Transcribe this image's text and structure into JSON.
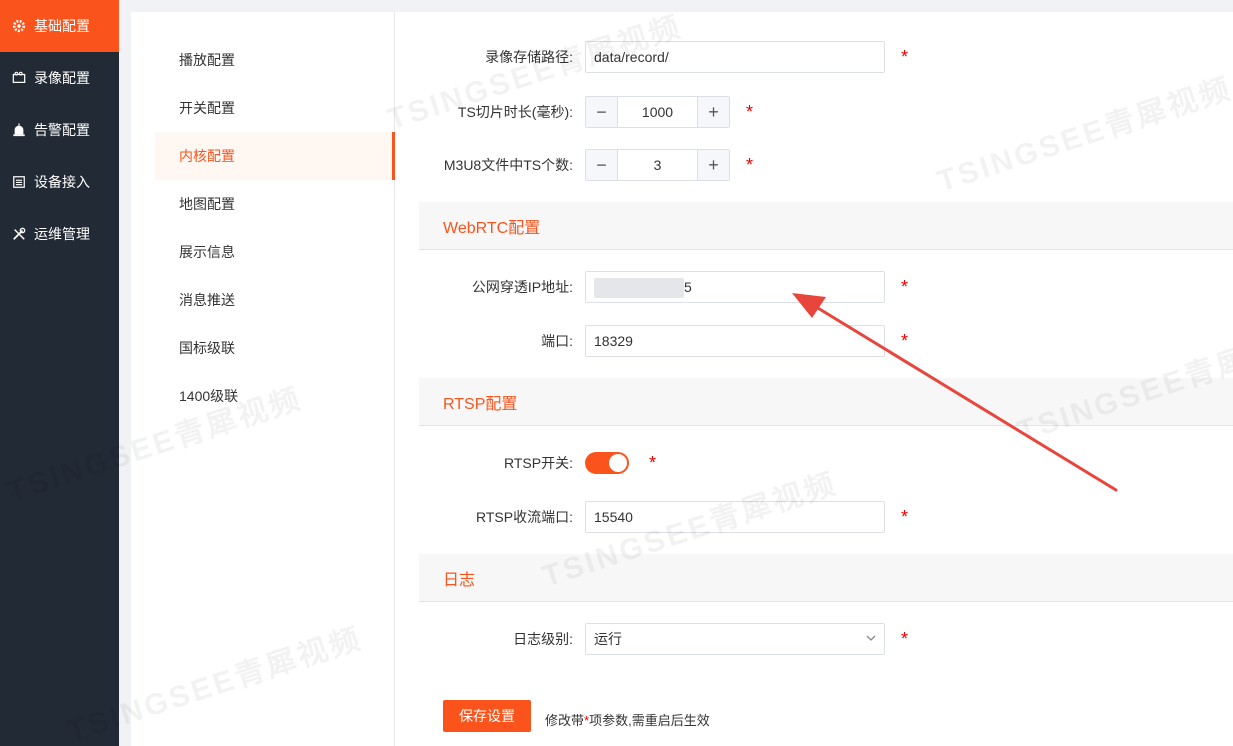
{
  "sidebar": {
    "items": [
      {
        "label": "基础配置",
        "icon": "gear-icon",
        "active": true
      },
      {
        "label": "录像配置",
        "icon": "video-icon",
        "active": false
      },
      {
        "label": "告警配置",
        "icon": "alarm-icon",
        "active": false
      },
      {
        "label": "设备接入",
        "icon": "device-icon",
        "active": false
      },
      {
        "label": "运维管理",
        "icon": "tools-icon",
        "active": false
      }
    ]
  },
  "submenu": {
    "items": [
      "播放配置",
      "开关配置",
      "内核配置",
      "地图配置",
      "展示信息",
      "消息推送",
      "国标级联",
      "1400级联"
    ],
    "active_index": 2
  },
  "form": {
    "record_path": {
      "label": "录像存储路径:",
      "value": "data/record/"
    },
    "ts_duration": {
      "label": "TS切片时长(毫秒):",
      "value": "1000",
      "minus": "−",
      "plus": "+"
    },
    "m3u8_count": {
      "label": "M3U8文件中TS个数:",
      "value": "3",
      "minus": "−",
      "plus": "+"
    },
    "webrtc_section": "WebRTC配置",
    "public_ip": {
      "label": "公网穿透IP地址:",
      "value": "5"
    },
    "port": {
      "label": "端口:",
      "value": "18329"
    },
    "rtsp_section": "RTSP配置",
    "rtsp_switch": {
      "label": "RTSP开关:",
      "on": true
    },
    "rtsp_port": {
      "label": "RTSP收流端口:",
      "value": "15540"
    },
    "log_section": "日志",
    "log_level": {
      "label": "日志级别:",
      "value": "运行"
    },
    "required_mark": "*"
  },
  "footer": {
    "save_label": "保存设置",
    "hint_prefix": "修改带",
    "hint_star": "*",
    "hint_suffix": "项参数,需重启后生效"
  },
  "watermark_text": "TSINGSEE青犀视频",
  "colors": {
    "accent": "#fa541c",
    "sidebar_bg": "#222a35",
    "required": "#e00000"
  }
}
